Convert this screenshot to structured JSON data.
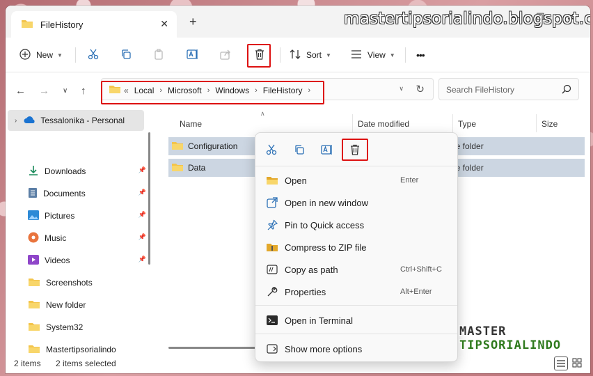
{
  "watermark": {
    "site": "mastertipsorialindo.blogspot.com",
    "logo_line1": "MASTER",
    "logo_line2": "TIPSORIALINDO"
  },
  "window": {
    "tab_title": "FileHistory",
    "new_tab": "+",
    "minimize": "—",
    "maximize": "☐",
    "close": "✕",
    "tab_close": "✕"
  },
  "commandbar": {
    "new_label": "New",
    "sort_label": "Sort",
    "view_label": "View",
    "more": "•••"
  },
  "address": {
    "overflow": "«",
    "crumbs": [
      "Local",
      "Microsoft",
      "Windows",
      "FileHistory"
    ],
    "separator": "›",
    "search_placeholder": "Search FileHistory"
  },
  "navigation": {
    "home": "Tessalonika - Personal",
    "items": [
      {
        "label": "Downloads",
        "icon": "download-icon",
        "pinned": true
      },
      {
        "label": "Documents",
        "icon": "documents-icon",
        "pinned": true
      },
      {
        "label": "Pictures",
        "icon": "pictures-icon",
        "pinned": true
      },
      {
        "label": "Music",
        "icon": "music-icon",
        "pinned": true
      },
      {
        "label": "Videos",
        "icon": "videos-icon",
        "pinned": true
      },
      {
        "label": "Screenshots",
        "icon": "folder-icon",
        "pinned": false
      },
      {
        "label": "New folder",
        "icon": "folder-icon",
        "pinned": false
      },
      {
        "label": "System32",
        "icon": "folder-icon",
        "pinned": false
      },
      {
        "label": "Mastertipsorialindo",
        "icon": "folder-icon",
        "pinned": false
      }
    ]
  },
  "columns": {
    "name": "Name",
    "date": "Date modified",
    "type": "Type",
    "size": "Size"
  },
  "files": [
    {
      "name": "Configuration",
      "type": "le folder"
    },
    {
      "name": "Data",
      "type": "le folder"
    }
  ],
  "context_menu": {
    "items": [
      {
        "label": "Open",
        "shortcut": "Enter",
        "icon": "folder-open-icon"
      },
      {
        "label": "Open in new window",
        "shortcut": "",
        "icon": "open-new-window-icon"
      },
      {
        "label": "Pin to Quick access",
        "shortcut": "",
        "icon": "pin-icon"
      },
      {
        "label": "Compress to ZIP file",
        "shortcut": "",
        "icon": "zip-icon"
      },
      {
        "label": "Copy as path",
        "shortcut": "Ctrl+Shift+C",
        "icon": "copy-path-icon"
      },
      {
        "label": "Properties",
        "shortcut": "Alt+Enter",
        "icon": "properties-icon"
      },
      {
        "label": "Open in Terminal",
        "shortcut": "",
        "icon": "terminal-icon"
      },
      {
        "label": "Show more options",
        "shortcut": "",
        "icon": "more-options-icon"
      }
    ]
  },
  "status": {
    "count": "2 items",
    "selected": "2 items selected"
  },
  "colors": {
    "highlight": "#dd1111",
    "selection": "#ccd6e2",
    "folder": "#f3c44b",
    "accent": "#0067c0"
  }
}
